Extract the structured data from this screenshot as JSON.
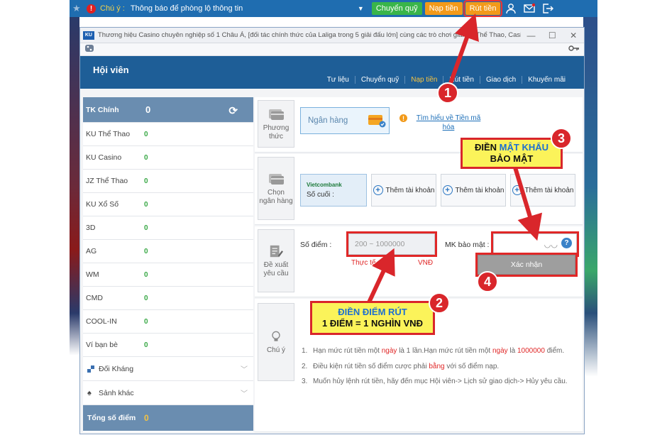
{
  "topbar": {
    "notice_label": "Chú ý :",
    "notice_text": "Thông báo để phòng lộ thông tin",
    "btn_transfer": "Chuyển quỹ",
    "btn_deposit": "Nạp tiền",
    "btn_withdraw": "Rút tiền",
    "icons": [
      "star-icon",
      "warning-icon",
      "user-icon",
      "mail-icon",
      "logout-icon"
    ]
  },
  "window": {
    "logo": "KU",
    "title": "Thương hiệu Casino chuyên nghiệp số 1 Châu Á, [đối tác chính thức của Laliga trong 5 giải đấu lớn] cùng các trò chơi giải trí (Thể Thao, Casino, E-S...",
    "min": "—",
    "max": "☐",
    "close": "✕"
  },
  "member": {
    "title": "Hội viên",
    "tabs": [
      {
        "label": "Tư liệu"
      },
      {
        "label": "Chuyển quỹ"
      },
      {
        "label": "Nạp tiền"
      },
      {
        "label": "Rút tiền"
      },
      {
        "label": "Giao dịch"
      },
      {
        "label": "Khuyến mãi"
      }
    ]
  },
  "sidebar": {
    "main_label": "TK Chính",
    "main_value": "0",
    "items": [
      {
        "label": "KU Thể Thao",
        "value": "0"
      },
      {
        "label": "KU Casino",
        "value": "0"
      },
      {
        "label": "JZ Thể Thao",
        "value": "0"
      },
      {
        "label": "KU Xổ Số",
        "value": "0"
      },
      {
        "label": "3D",
        "value": "0"
      },
      {
        "label": "AG",
        "value": "0"
      },
      {
        "label": "WM",
        "value": "0"
      },
      {
        "label": "CMD",
        "value": "0"
      },
      {
        "label": "COOL-IN",
        "value": "0"
      },
      {
        "label": "Ví bạn bè",
        "value": "0"
      }
    ],
    "group_1": "Đối Kháng",
    "group_2": "Sảnh khác",
    "total_label": "Tổng số điểm",
    "total_value": "0"
  },
  "method": {
    "label_1": "Phương",
    "label_2": "thức",
    "bank_button": "Ngân hàng",
    "info_mark": "!",
    "info_link": "Tìm hiểu về Tiền mã hóa"
  },
  "choose_bank": {
    "label_1": "Chọn",
    "label_2": "ngân hàng",
    "vcb_name": "Vietcombank",
    "vcb_last": "Số cuối :",
    "add_account": "Thêm tài khoản"
  },
  "form": {
    "label_1": "Đề xuất",
    "label_2": "yêu cầu",
    "points_label": "Số điểm :",
    "points_placeholder": "200 ~ 1000000",
    "actual_label": "Thực tế : 0",
    "currency": "VNĐ",
    "password_label": "MK bảo mật :",
    "help": "?",
    "confirm": "Xác nhận"
  },
  "notes": {
    "label": "Chú ý",
    "n1_a": "Hạn mức rút tiền một ",
    "n1_b": "ngày",
    "n1_c": " là 1 lần.Hạn mức rút tiền một ",
    "n1_d": "ngày",
    "n1_e": " là ",
    "n1_f": "1000000",
    "n1_g": " điểm.",
    "n2_a": "Điều kiện rút tiền số điểm cược phải ",
    "n2_b": "bằng",
    "n2_c": " với số điểm nạp.",
    "n3": "Muốn hủy lệnh rút tiền, hãy đến mục Hội viên-> Lịch sử giao dịch-> Hủy yêu cầu."
  },
  "callouts": {
    "c2_line1": "ĐIỀN ĐIỂM RÚT",
    "c2_line2": "1 ĐIỂM = 1 NGHÌN VNĐ",
    "c3_a": "ĐIỀN ",
    "c3_b": "MẬT KHẨU",
    "c3_c": "BẢO MẬT",
    "b1": "1",
    "b2": "2",
    "b3": "3",
    "b4": "4"
  },
  "colors": {
    "topbar": "#1f6db0",
    "member_header": "#1e5e97",
    "sidebar_head": "#6a8db0",
    "accent_green": "#39b54a",
    "accent_orange": "#f29a1a",
    "annotation_red": "#d9262b",
    "callout_yellow": "#fbf35a"
  }
}
